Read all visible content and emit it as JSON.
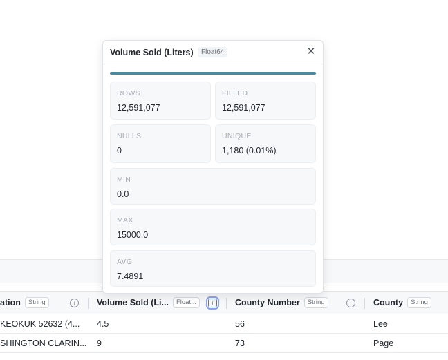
{
  "popover": {
    "title": "Volume Sold (Liters)",
    "type": "Float64",
    "fill_fraction": 1.0,
    "stats": {
      "rows": {
        "label": "ROWS",
        "value": "12,591,077"
      },
      "filled": {
        "label": "FILLED",
        "value": "12,591,077"
      },
      "nulls": {
        "label": "NULLS",
        "value": "0"
      },
      "unique": {
        "label": "UNIQUE",
        "value": "1,180 (0.01%)"
      },
      "min": {
        "label": "MIN",
        "value": "0.0"
      },
      "max": {
        "label": "MAX",
        "value": "15000.0"
      },
      "avg": {
        "label": "AVG",
        "value": "7.4891"
      }
    }
  },
  "table": {
    "columns": [
      {
        "label": "ation",
        "type": "String"
      },
      {
        "label": "Volume Sold (Li...",
        "type": "Float..."
      },
      {
        "label": "County Number",
        "type": "String"
      },
      {
        "label": "County",
        "type": "String"
      }
    ],
    "rows": [
      [
        "KEOKUK 52632 (4...",
        "4.5",
        "56",
        "Lee"
      ],
      [
        "SHINGTON CLARIN...",
        "9",
        "73",
        "Page"
      ]
    ]
  },
  "colors": {
    "fill_bar": "#4a8a9e",
    "active_info": "#5470c6"
  },
  "icons": {
    "close": "close-icon",
    "info": "info-icon"
  }
}
